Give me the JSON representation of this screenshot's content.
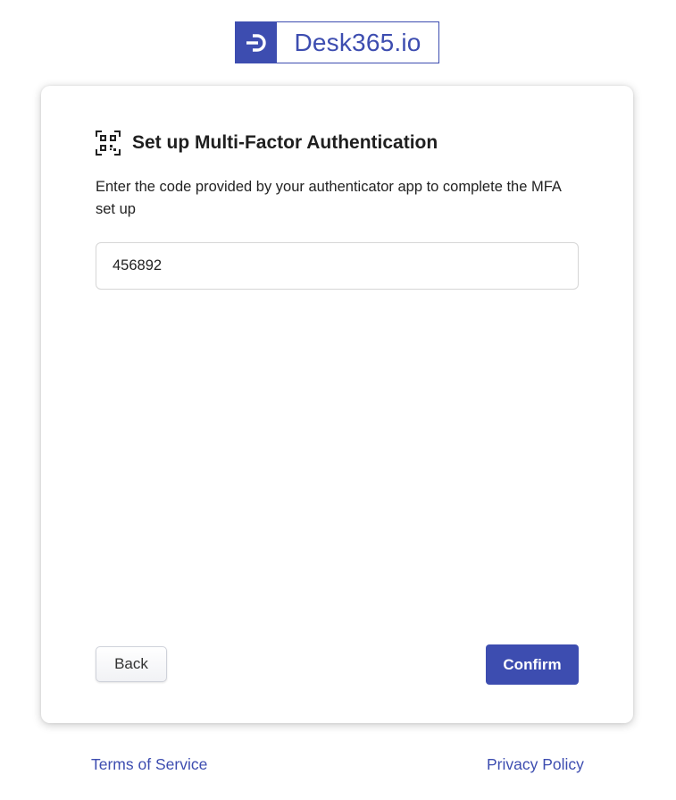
{
  "brand": {
    "name": "Desk365.io",
    "color": "#3d4db0"
  },
  "mfa": {
    "icon": "qr-code-icon",
    "title": "Set up Multi-Factor Authentication",
    "description": "Enter the code provided by your authenticator app to complete the MFA set up",
    "code_value": "456892"
  },
  "actions": {
    "back_label": "Back",
    "confirm_label": "Confirm"
  },
  "footer": {
    "terms_label": "Terms of Service",
    "privacy_label": "Privacy Policy"
  }
}
